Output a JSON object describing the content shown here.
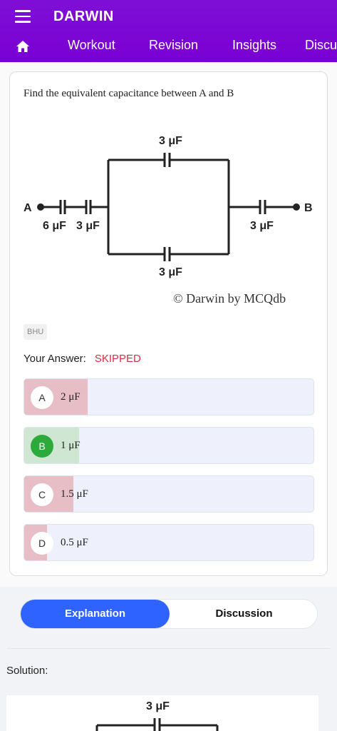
{
  "app": {
    "title": "DARWIN",
    "nav_tabs": [
      "Workout",
      "Revision",
      "Insights",
      "Discu"
    ]
  },
  "question": {
    "text": "Find the equivalent capacitance between A and B",
    "tag": "BHU",
    "your_answer_label": "Your Answer:",
    "your_answer_value": "SKIPPED"
  },
  "diagram": {
    "labels": {
      "top": "3 μF",
      "bottom": "3 μF",
      "left1": "6 μF",
      "left2": "3 μF",
      "right": "3 μF",
      "a": "A",
      "b": "B"
    },
    "watermark": "© Darwin by MCQdb"
  },
  "options": [
    {
      "letter": "A",
      "text": "2 μF",
      "state": "wrong",
      "share": 0.22
    },
    {
      "letter": "B",
      "text": "1 μF",
      "state": "correct",
      "share": 0.19
    },
    {
      "letter": "C",
      "text": "1.5 μF",
      "state": "wrong",
      "share": 0.17
    },
    {
      "letter": "D",
      "text": "0.5 μF",
      "state": "wrong",
      "share": 0.08
    }
  ],
  "tabs": {
    "explanation": "Explanation",
    "discussion": "Discussion"
  },
  "solution": {
    "label": "Solution:",
    "figure_label": "3 μF"
  },
  "colors": {
    "header": "#7a00d3",
    "accent": "#2f63ff",
    "wrong_fill": "#e8bec6",
    "correct_fill": "#cfe6d3",
    "correct_badge": "#2eaa3a",
    "skipped": "#d32f46"
  }
}
